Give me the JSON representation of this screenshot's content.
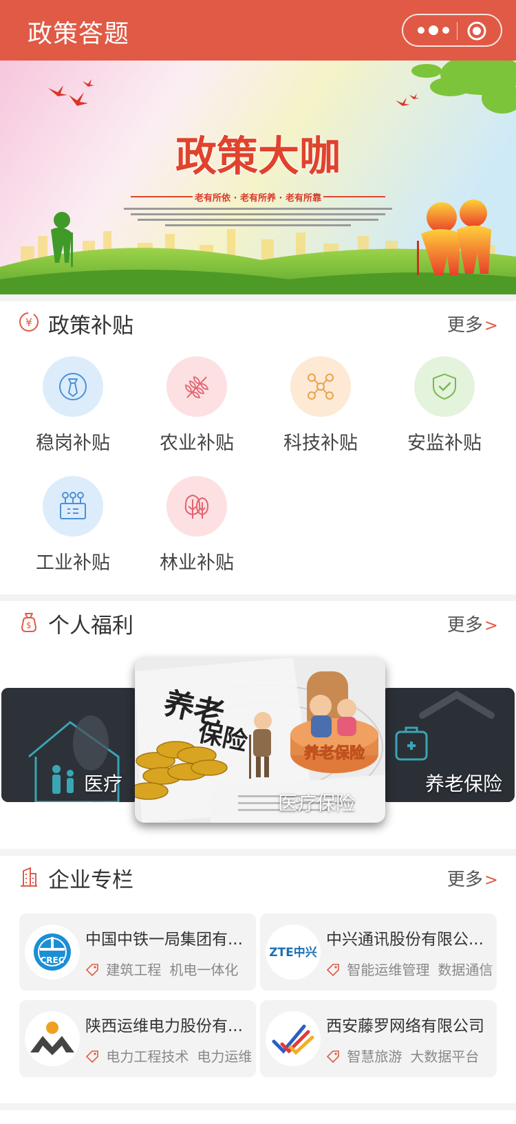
{
  "header": {
    "title": "政策答题"
  },
  "banner": {
    "title": "政策大咖",
    "subtitle": "老有所依 · 老有所养 · 老有所靠"
  },
  "policy": {
    "title": "政策补贴",
    "more": "更多",
    "items": [
      {
        "label": "稳岗补贴",
        "icon": "tie-icon",
        "bg": "#dcecfb",
        "fg": "#4a90d9"
      },
      {
        "label": "农业补贴",
        "icon": "leaf-icon",
        "bg": "#fde0e2",
        "fg": "#e06470"
      },
      {
        "label": "科技补贴",
        "icon": "molecule-icon",
        "bg": "#fde9d4",
        "fg": "#eaa14a"
      },
      {
        "label": "安监补贴",
        "icon": "shield-check-icon",
        "bg": "#e4f3dc",
        "fg": "#78b84f"
      },
      {
        "label": "工业补贴",
        "icon": "machine-icon",
        "bg": "#dcecfb",
        "fg": "#4a90d9"
      },
      {
        "label": "林业补贴",
        "icon": "tree-icon",
        "bg": "#fde0e2",
        "fg": "#e06470"
      }
    ]
  },
  "welfare": {
    "title": "个人福利",
    "more": "更多",
    "slides": {
      "left": "医疗保",
      "center_badge": "养老保险",
      "center": "医疗保险",
      "right": "养老保险"
    }
  },
  "enterprise": {
    "title": "企业专栏",
    "more": "更多",
    "companies": [
      {
        "name": "中国中铁一局集团有...",
        "tags": [
          "建筑工程",
          "机电一体化"
        ],
        "logo": "crec-logo"
      },
      {
        "name": "中兴通讯股份有限公...",
        "tags": [
          "智能运维管理",
          "数据通信"
        ],
        "logo": "zte-logo",
        "logo_text": "ZTE中兴"
      },
      {
        "name": "陕西运维电力股份有...",
        "tags": [
          "电力工程技术",
          "电力运维"
        ],
        "logo": "mountain-sun-logo"
      },
      {
        "name": "西安藤罗网络有限公司",
        "tags": [
          "智慧旅游",
          "大数据平台"
        ],
        "logo": "check-marks-logo"
      }
    ]
  },
  "colors": {
    "accent": "#e05a45"
  }
}
